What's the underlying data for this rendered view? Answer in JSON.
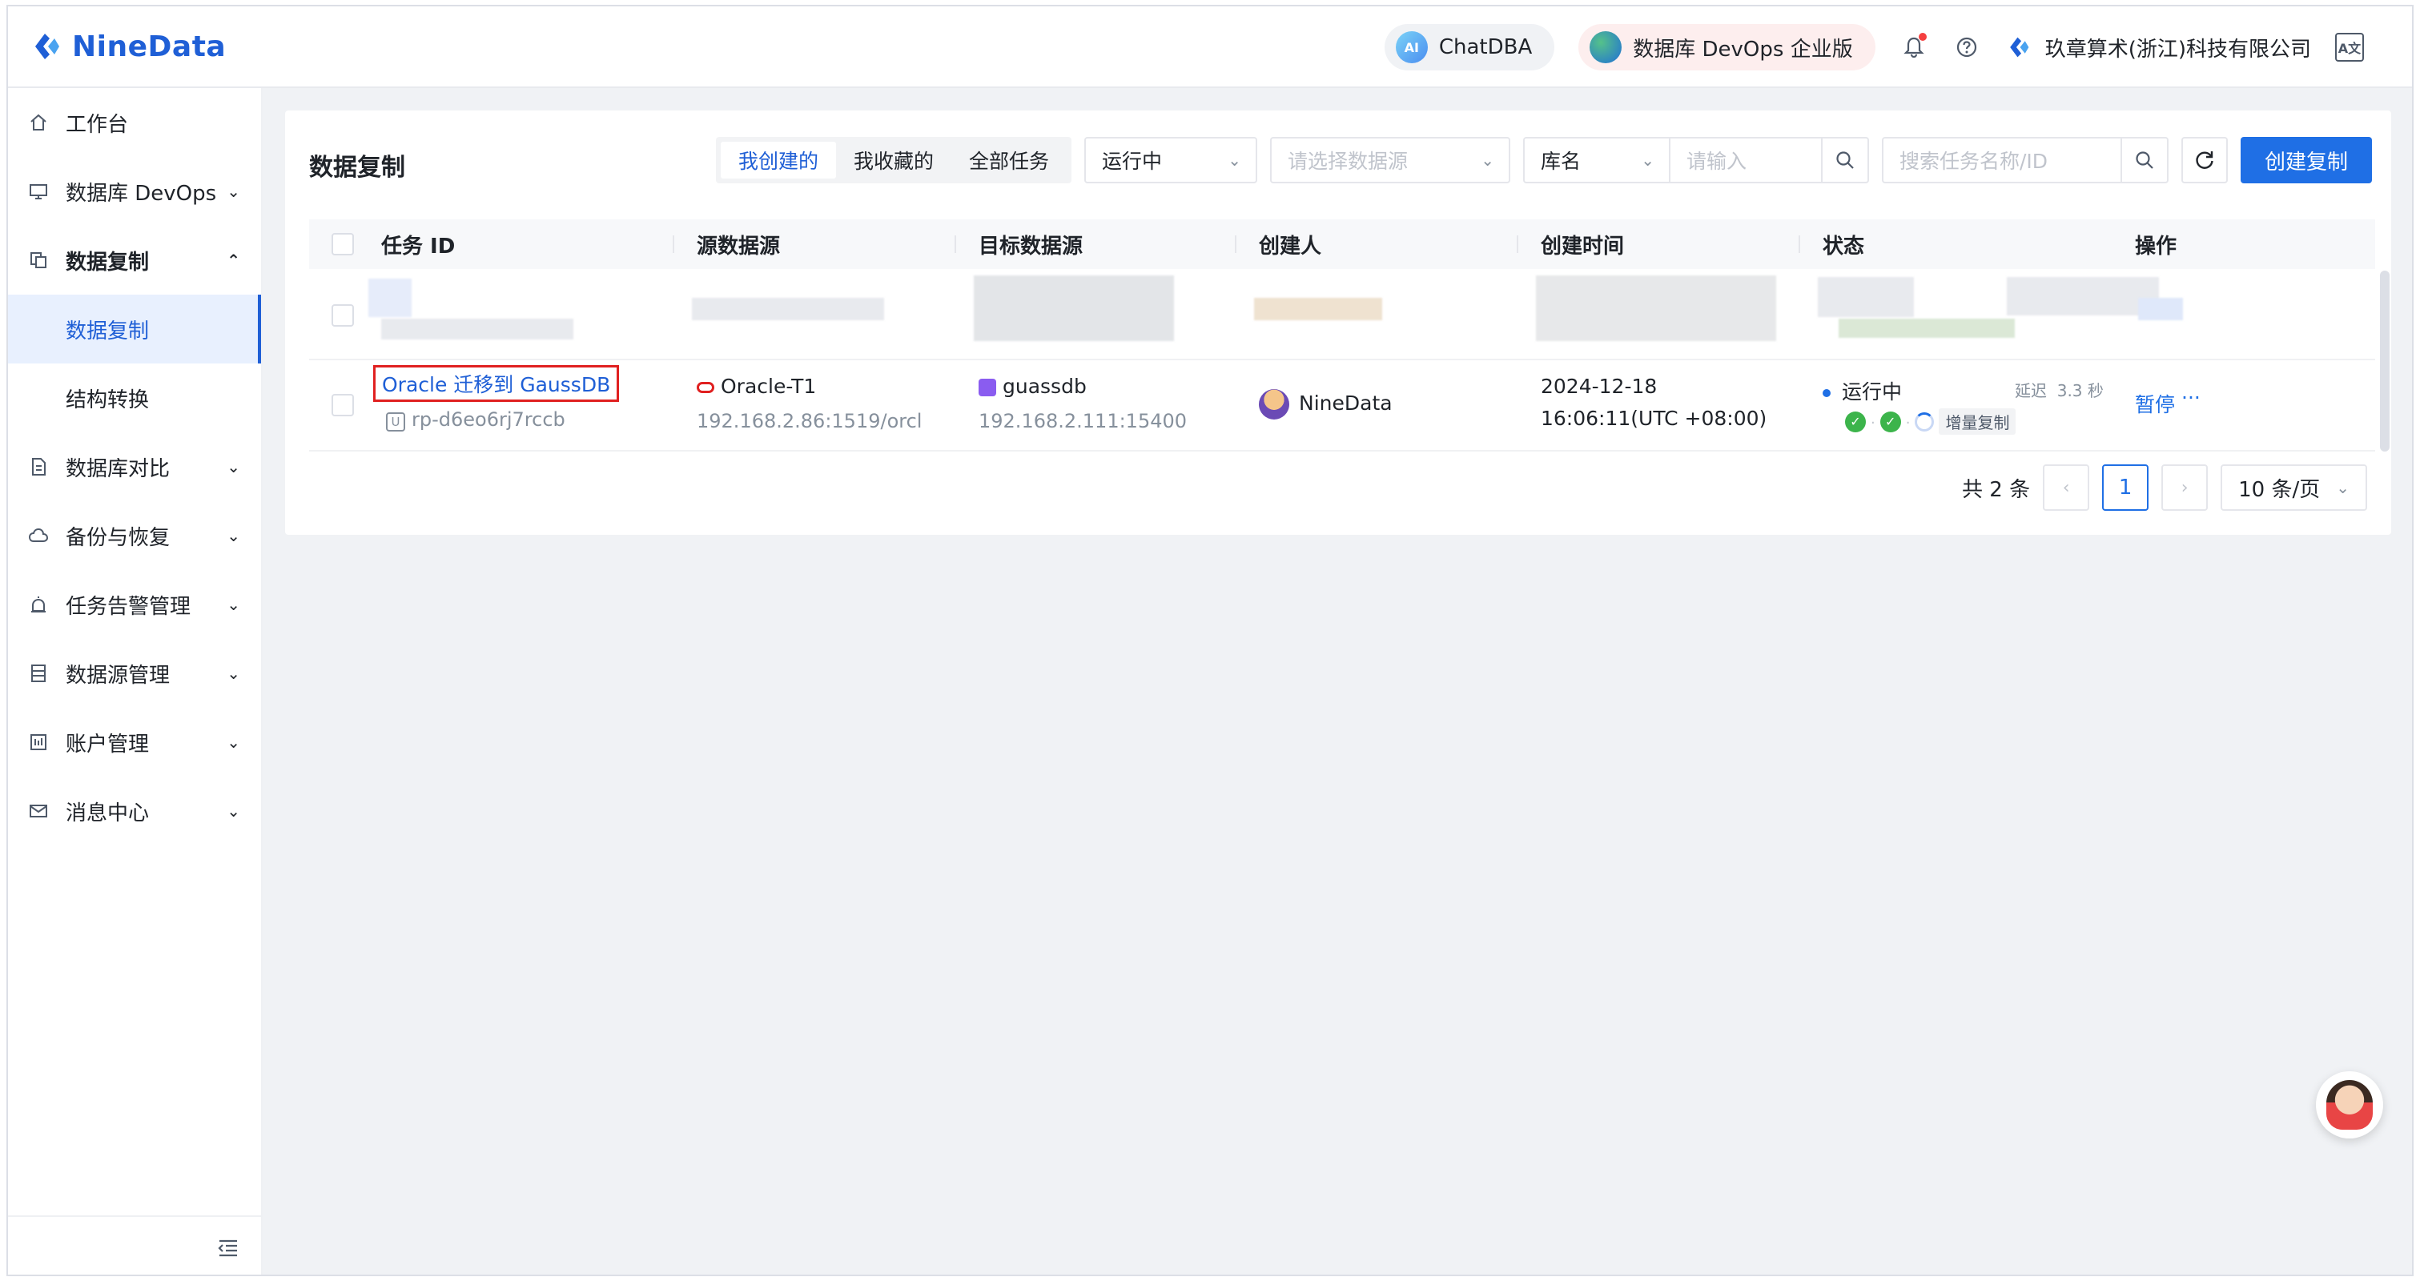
{
  "app": {
    "logo_text": "NineData",
    "brand_color": "#1f5fd6",
    "accent_color": "#1f6fe5"
  },
  "topbar": {
    "chatdba_label": "ChatDBA",
    "chatdba_icon": "AI",
    "devops_label": "数据库 DevOps 企业版",
    "company_name": "玖章算术(浙江)科技有限公司",
    "lang_icon": "A文"
  },
  "sidebar": {
    "items": [
      {
        "label": "工作台",
        "icon": "home-icon"
      },
      {
        "label": "数据库 DevOps",
        "icon": "monitor-icon"
      },
      {
        "label": "数据复制",
        "icon": "copy-icon"
      },
      {
        "label": "数据复制",
        "icon": ""
      },
      {
        "label": "结构转换",
        "icon": ""
      },
      {
        "label": "数据库对比",
        "icon": "compare-icon"
      },
      {
        "label": "备份与恢复",
        "icon": "cloud-icon"
      },
      {
        "label": "任务告警管理",
        "icon": "alarm-icon"
      },
      {
        "label": "数据源管理",
        "icon": "datasource-icon"
      },
      {
        "label": "账户管理",
        "icon": "account-icon"
      },
      {
        "label": "消息中心",
        "icon": "mail-icon"
      }
    ]
  },
  "main": {
    "title": "数据复制",
    "tabs": [
      "我创建的",
      "我收藏的",
      "全部任务"
    ],
    "status_select": "运行中",
    "datasource_placeholder": "请选择数据源",
    "db_select": "库名",
    "db_input_placeholder": "请输入",
    "search_placeholder": "搜索任务名称/ID",
    "create_button": "创建复制"
  },
  "table": {
    "columns": [
      "任务 ID",
      "源数据源",
      "目标数据源",
      "创建人",
      "创建时间",
      "状态",
      "操作"
    ],
    "row": {
      "task_name": "Oracle 迁移到 GaussDB",
      "task_id_badge": "U",
      "task_id": "rp-d6eo6rj7rccb",
      "source_name": "Oracle-T1",
      "source_addr": "192.168.2.86:1519/orcl",
      "target_name": "guassdb",
      "target_addr": "192.168.2.111:15400",
      "creator": "NineData",
      "created_date": "2024-12-18",
      "created_time": "16:06:11(UTC +08:00)",
      "status": "运行中",
      "delay_label": "延迟",
      "delay_value": "3.3 秒",
      "phase_tag": "增量复制",
      "action_pause": "暂停",
      "action_more": "···"
    }
  },
  "pagination": {
    "total": "共 2 条",
    "current_page": "1",
    "page_size": "10 条/页"
  }
}
